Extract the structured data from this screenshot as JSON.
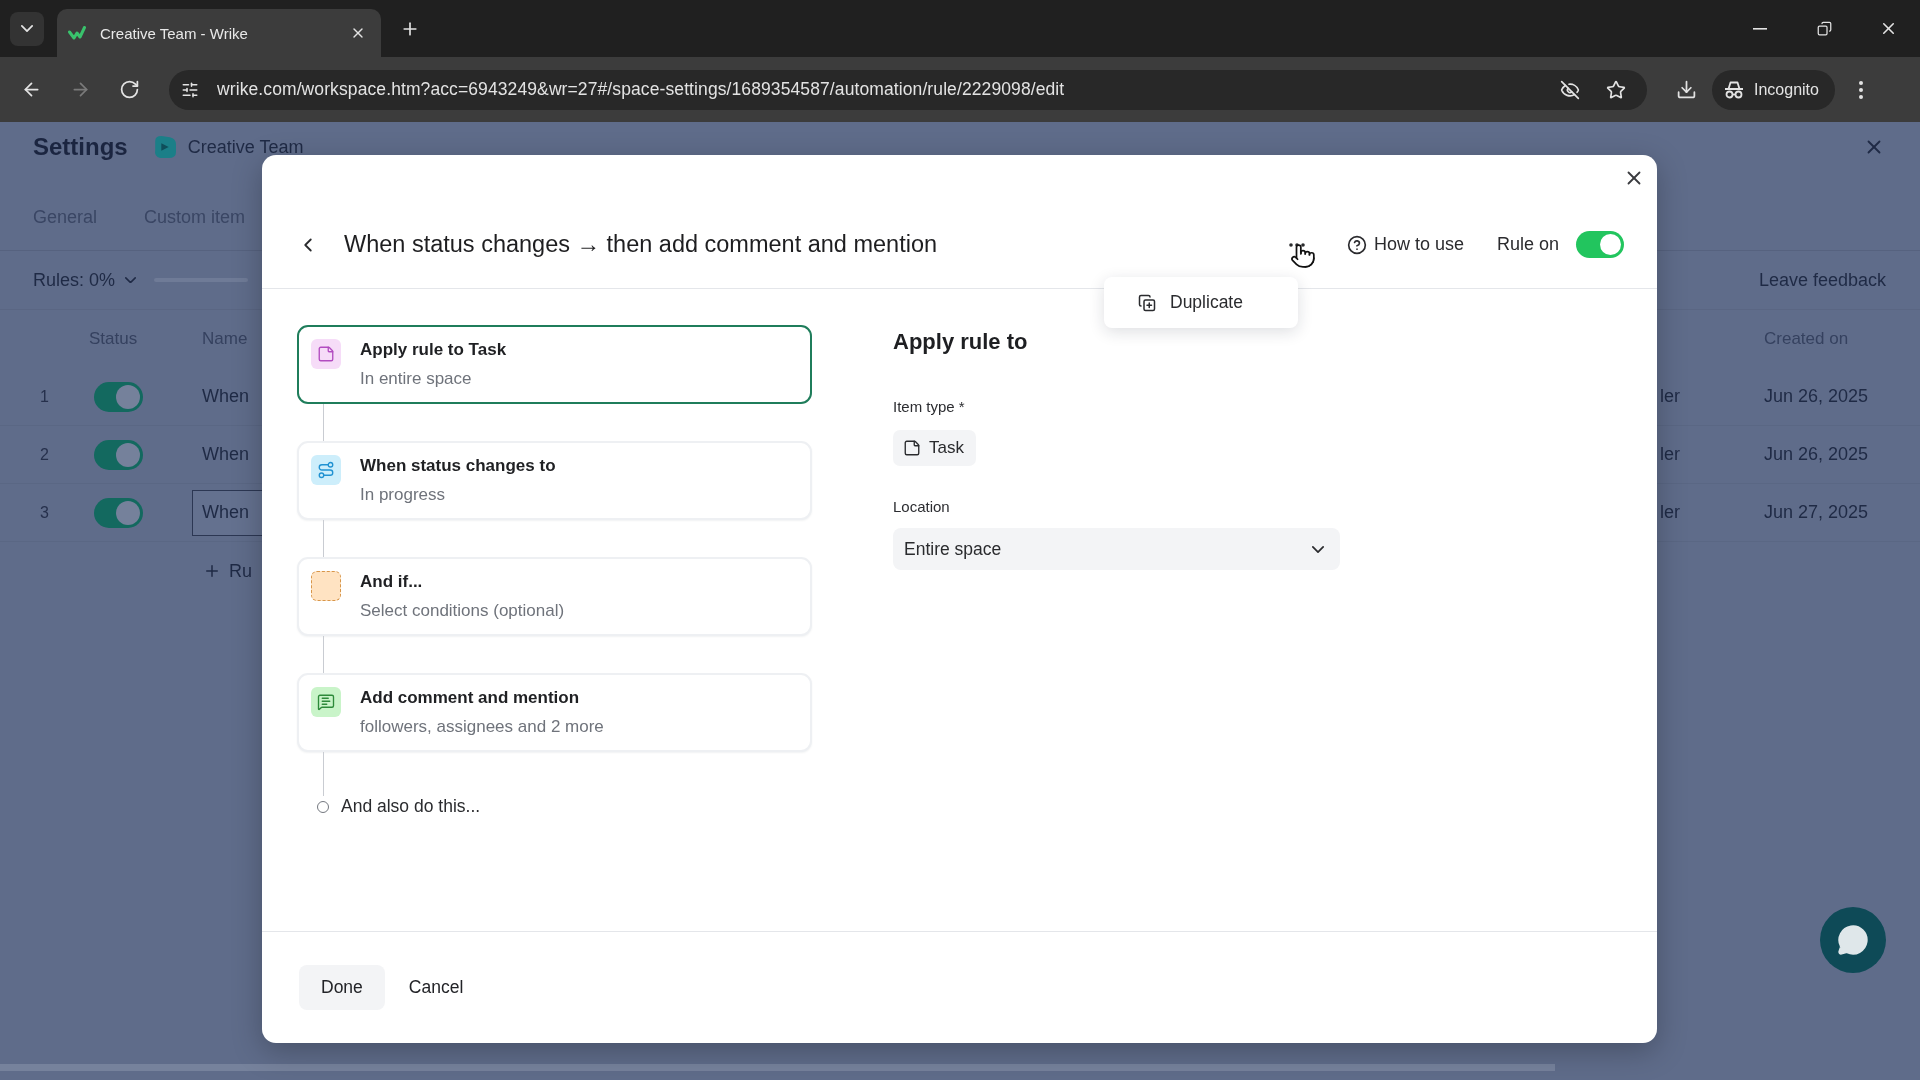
{
  "browser": {
    "tab": {
      "title": "Creative Team - Wrike"
    },
    "nav_buttons": [
      {
        "kind": "back",
        "disabled": false
      },
      {
        "kind": "forward",
        "disabled": true
      },
      {
        "kind": "reload",
        "disabled": false
      }
    ],
    "url": "wrike.com/workspace.htm?acc=6943249&wr=27#/space-settings/1689354587/automation/rule/2229098/edit",
    "profile": "Incognito"
  },
  "settings": {
    "title": "Settings",
    "space": "Creative Team",
    "tabs": [
      {
        "label": "General",
        "selected": false
      },
      {
        "label": "Custom item",
        "selected": false
      }
    ],
    "rules_filter": {
      "label": "Rules: 0%",
      "level": 0
    },
    "feedback": "Leave feedback",
    "table": {
      "columns": [
        "Status",
        "Name",
        "Created on"
      ],
      "rows": [
        {
          "number": "1",
          "on": true,
          "name": "When",
          "focused": false,
          "column_4": "ler",
          "created_on": "Jun 26, 2025"
        },
        {
          "number": "2",
          "on": true,
          "name": "When",
          "focused": false,
          "column_4": "ler",
          "created_on": "Jun 26, 2025"
        },
        {
          "number": "3",
          "on": true,
          "name": "When",
          "focused": true,
          "column_4": "ler",
          "created_on": "Jun 27, 2025"
        }
      ]
    },
    "add_rule": "Ru"
  },
  "modal": {
    "title": "When status changes → then add comment and mention",
    "help": "How to use",
    "rule_toggle": {
      "label": "Rule on",
      "on": true
    },
    "menu": {
      "items": [
        {
          "label": "Duplicate",
          "kind": "duplicate"
        }
      ]
    },
    "steps": [
      {
        "kind": "scope",
        "title": "Apply rule to Task",
        "subtitle": "In entire space",
        "selected": true
      },
      {
        "kind": "trigger",
        "title": "When status changes to",
        "subtitle": "In progress",
        "selected": false
      },
      {
        "kind": "condition",
        "title": "And if...",
        "subtitle": "Select conditions (optional)",
        "selected": false
      },
      {
        "kind": "action",
        "title": "Add comment and mention",
        "subtitle": "followers, assignees and 2 more",
        "selected": false
      }
    ],
    "more_step": "And also do this...",
    "form": {
      "heading": "Apply rule to",
      "item_type": {
        "label": "Item type *",
        "value": "Task"
      },
      "location": {
        "label": "Location",
        "value": "Entire space"
      }
    },
    "buttons": [
      {
        "label": "Done",
        "kind": "primary"
      },
      {
        "label": "Cancel",
        "kind": "secondary"
      }
    ]
  }
}
